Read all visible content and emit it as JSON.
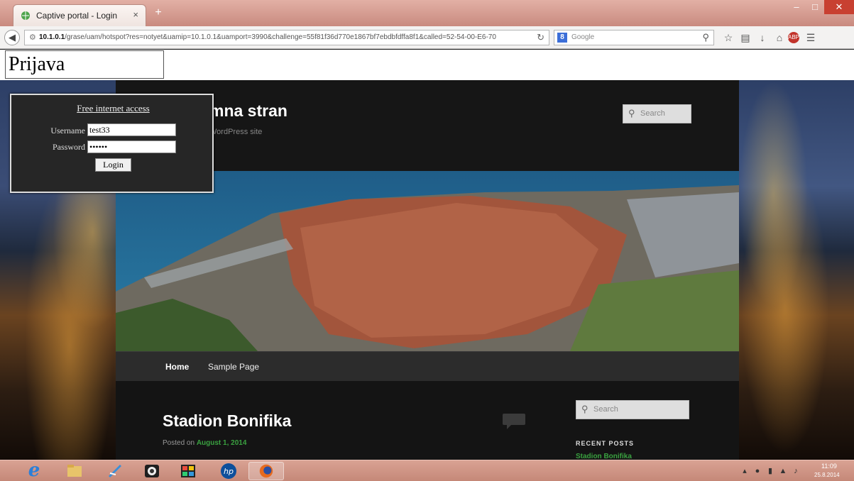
{
  "browser": {
    "tab_title": "Captive portal - Login",
    "tab_close": "×",
    "new_tab": "+",
    "url_host": "10.1.0.1",
    "url_path": "/grase/uam/hotspot?res=notyet&uamip=10.1.0.1&uamport=3990&challenge=55f81f36d770e1867bf7ebdbfdffa8f1&called=52-54-00-E6-70",
    "search_placeholder": "Google",
    "search_engine_letter": "8"
  },
  "page": {
    "prijava_label": "Prijava"
  },
  "login": {
    "heading": "Free internet access",
    "username_label": "Username",
    "password_label": "Password",
    "username_value": "test33",
    "password_value": "••••••",
    "login_button": "Login"
  },
  "wordpress": {
    "site_title_partial": "mna stran",
    "site_desc_partial": "WordPress site",
    "search_placeholder": "Search",
    "nav": [
      "Home",
      "Sample Page"
    ],
    "post_title": "Stadion Bonifika",
    "posted_on": "Posted on",
    "post_date": "August 1, 2014",
    "recent_heading": "RECENT POSTS",
    "recent_item": "Stadion Bonifika"
  },
  "taskbar": {
    "clock_time": "11:09",
    "clock_date": "25.8.2014",
    "hp_label": "hp"
  },
  "colors": {
    "link_green": "#3aa140",
    "titlebar": "#d9a293",
    "close_red": "#c84031"
  }
}
